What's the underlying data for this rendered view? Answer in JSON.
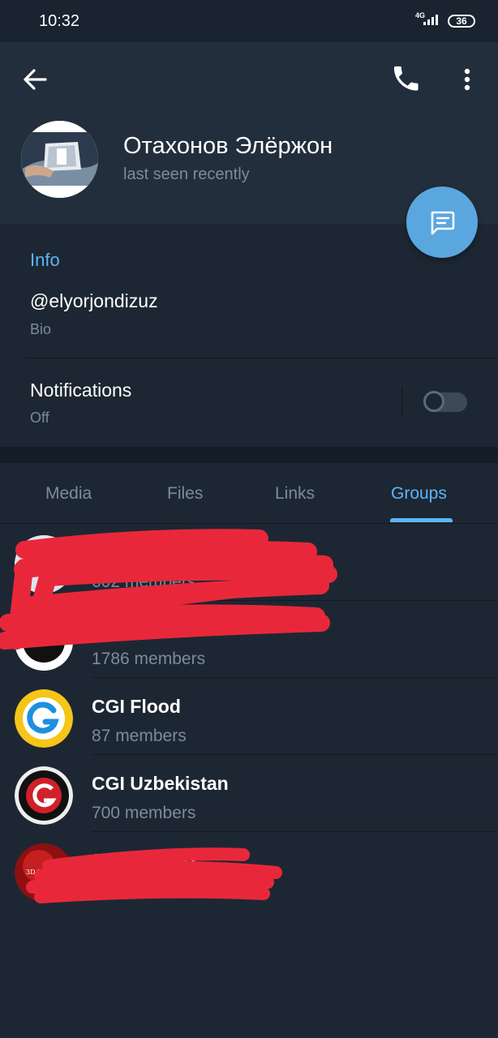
{
  "status_bar": {
    "time": "10:32",
    "network": "4G",
    "battery": "36"
  },
  "header": {
    "name": "Отахонов Элёржон",
    "status": "last seen recently"
  },
  "info": {
    "title": "Info",
    "username": "@elyorjondizuz",
    "bio_label": "Bio",
    "notifications_label": "Notifications",
    "notifications_value": "Off",
    "notifications_enabled": false
  },
  "tabs": [
    {
      "label": "Media",
      "active": false
    },
    {
      "label": "Files",
      "active": false
    },
    {
      "label": "Links",
      "active": false
    },
    {
      "label": "Groups",
      "active": true
    }
  ],
  "groups": [
    {
      "title": "",
      "members": "602 members",
      "redacted": true
    },
    {
      "title": "",
      "members": "1786 members",
      "redacted": true
    },
    {
      "title": "CGI Flood",
      "members": "87 members",
      "redacted": false
    },
    {
      "title": "CGI Uzbekistan",
      "members": "700 members",
      "redacted": false
    },
    {
      "title": "3DModel UZ",
      "members": "",
      "redacted": true,
      "avatar_text": "3D MODEL"
    }
  ],
  "colors": {
    "accent": "#5eb5f7",
    "fab": "#5aa7df",
    "redaction": "#e8283a",
    "header_bg": "#232e3c",
    "body_bg": "#1d2733"
  }
}
